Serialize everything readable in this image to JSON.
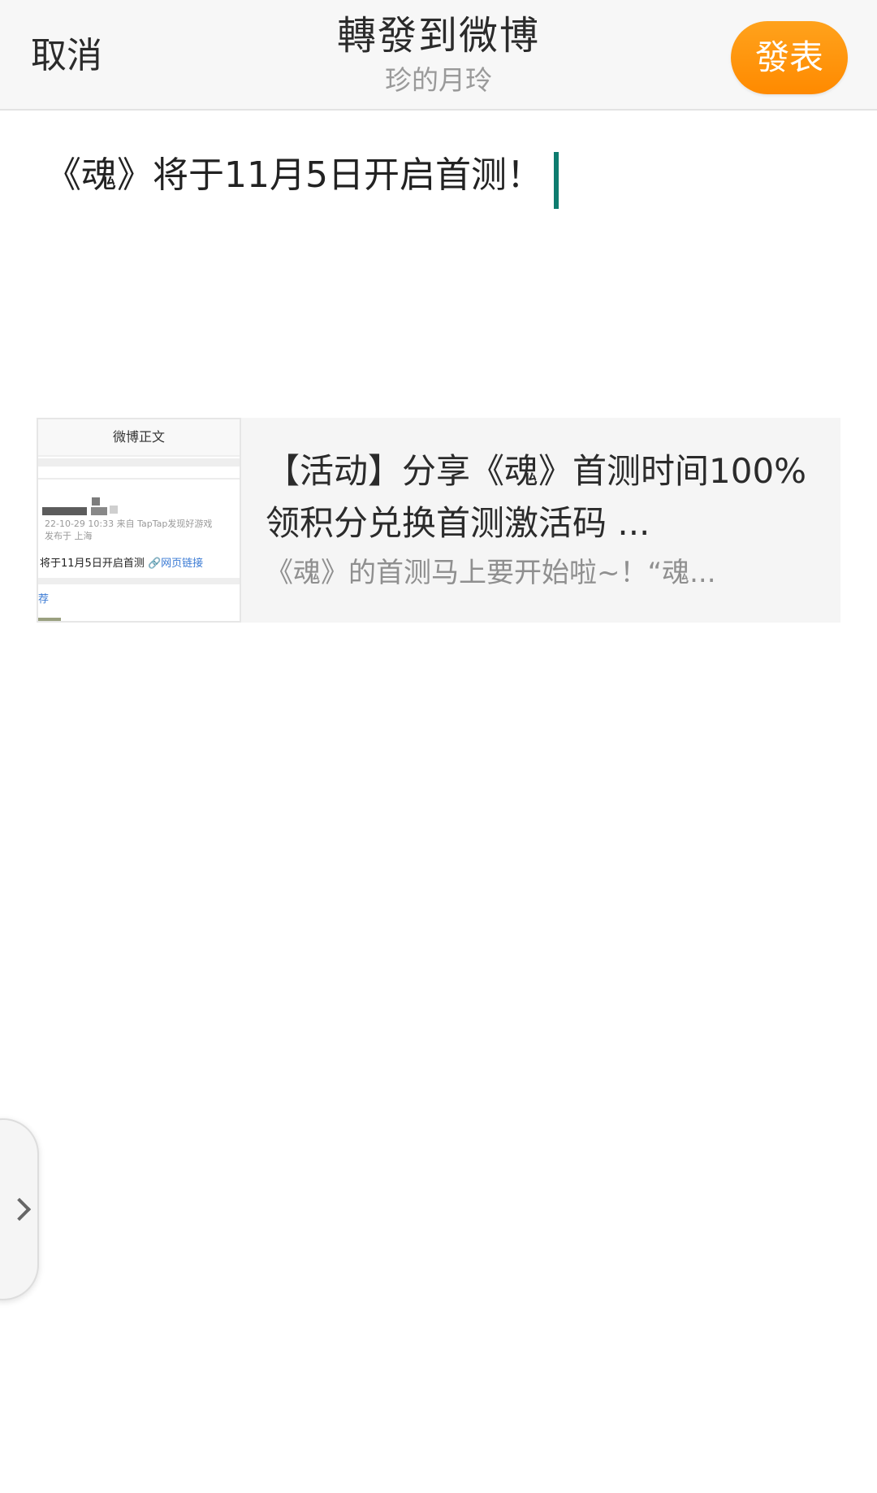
{
  "header": {
    "cancel_label": "取消",
    "title": "轉發到微博",
    "subtitle": "珍的月玲",
    "publish_label": "發表"
  },
  "compose": {
    "text": "《魂》将于11月5日开启首测！"
  },
  "shared_card": {
    "thumbnail": {
      "header": "微博正文",
      "meta_line1": "22-10-29 10:33  来自 TapTap发现好游戏",
      "meta_line2": "发布于 上海",
      "body": "将于11月5日开启首测 ",
      "link": "🔗网页链接",
      "tag": "荐"
    },
    "title": "【活动】分享《魂》首测时间100%领积分兑换首测激活码 ...",
    "description": "《魂》的首测马上要开始啦~！“魂..."
  },
  "side_handle": {
    "icon": "chevron-right-icon"
  },
  "colors": {
    "accent": "#ff9a0e",
    "caret": "#0e7c6f",
    "header_bg": "#f7f7f7",
    "card_bg": "#f5f5f5"
  }
}
